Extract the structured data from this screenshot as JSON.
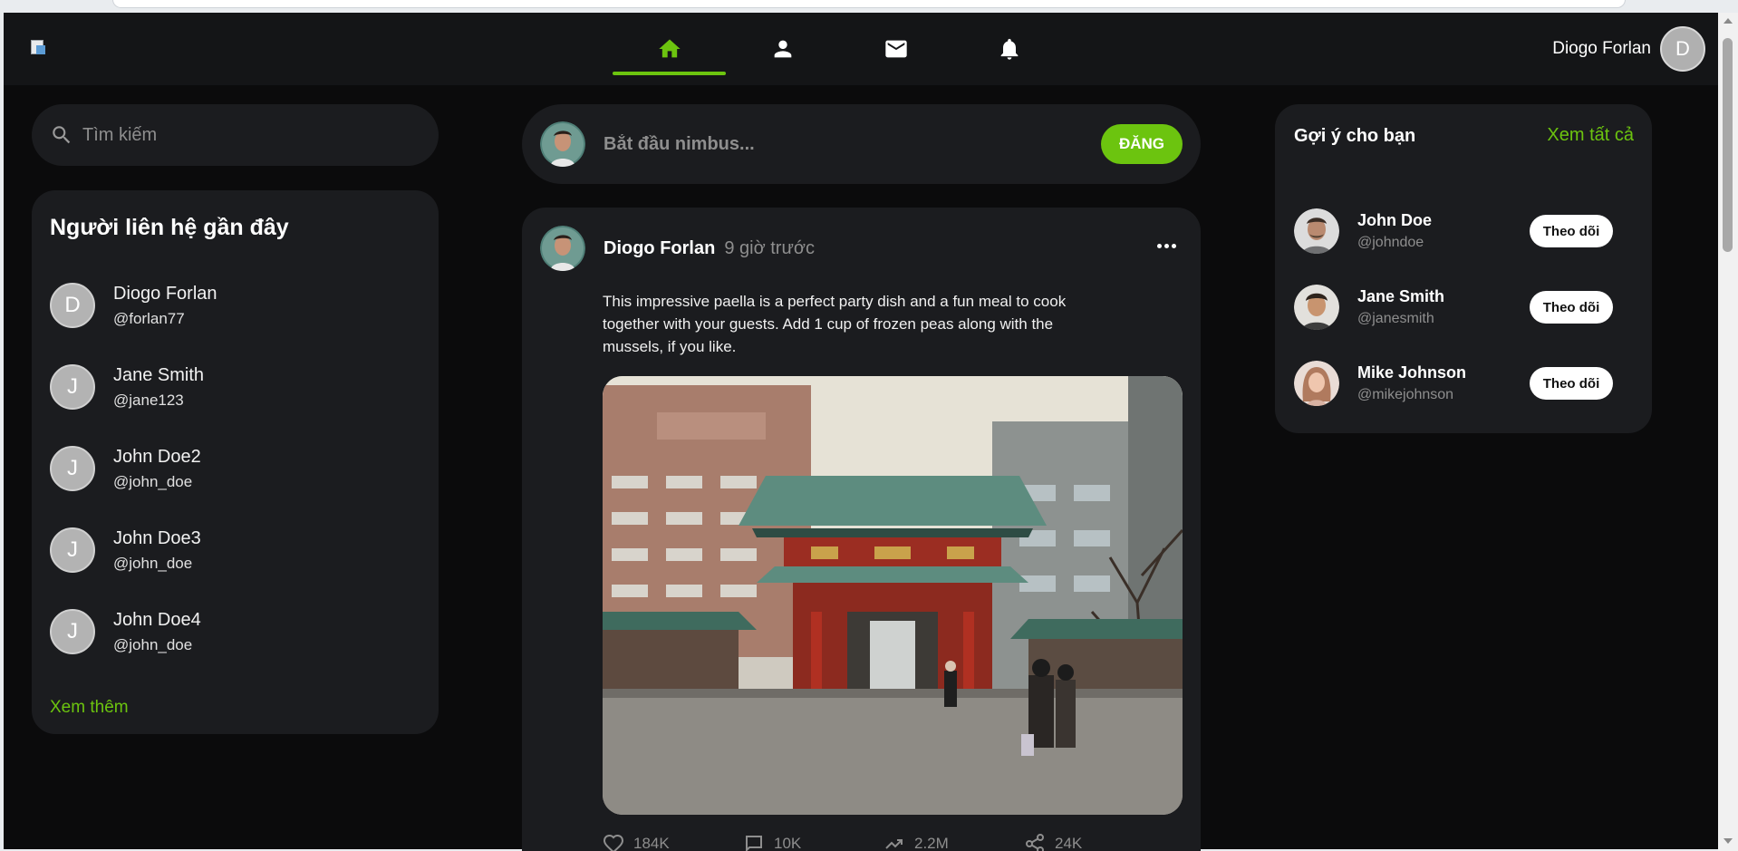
{
  "header": {
    "user_name": "Diogo Forlan",
    "user_initial": "D",
    "nav": [
      {
        "icon": "home-icon",
        "active": true
      },
      {
        "icon": "user-icon",
        "active": false
      },
      {
        "icon": "mail-icon",
        "active": false
      },
      {
        "icon": "bell-icon",
        "active": false
      }
    ]
  },
  "search": {
    "placeholder": "Tìm kiếm"
  },
  "contacts": {
    "title": "Người liên hệ gần đây",
    "items": [
      {
        "initial": "D",
        "name": "Diogo Forlan",
        "handle": "@forlan77"
      },
      {
        "initial": "J",
        "name": "Jane Smith",
        "handle": "@jane123"
      },
      {
        "initial": "J",
        "name": "John Doe2",
        "handle": "@john_doe"
      },
      {
        "initial": "J",
        "name": "John Doe3",
        "handle": "@john_doe"
      },
      {
        "initial": "J",
        "name": "John Doe4",
        "handle": "@john_doe"
      }
    ],
    "see_more": "Xem thêm"
  },
  "composer": {
    "placeholder": "Bắt đầu nimbus...",
    "post_label": "ĐĂNG"
  },
  "post": {
    "author": "Diogo Forlan",
    "time": "9 giờ trước",
    "text": "This impressive paella is a perfect party dish and a fun meal to cook together with your guests. Add 1 cup of frozen peas along with the mussels, if you like.",
    "actions": {
      "likes": "184K",
      "comments": "10K",
      "views": "2.2M",
      "shares": "24K"
    }
  },
  "suggestions": {
    "title": "Gợi ý cho bạn",
    "see_all": "Xem tất cả",
    "items": [
      {
        "name": "John Doe",
        "handle": "@johndoe",
        "follow": "Theo dõi"
      },
      {
        "name": "Jane Smith",
        "handle": "@janesmith",
        "follow": "Theo dõi"
      },
      {
        "name": "Mike Johnson",
        "handle": "@mikejohnson",
        "follow": "Theo dõi"
      }
    ]
  },
  "colors": {
    "accent": "#6cc40f",
    "background": "#0b0b0c",
    "card": "#1b1c1f",
    "nav": "#141517"
  }
}
